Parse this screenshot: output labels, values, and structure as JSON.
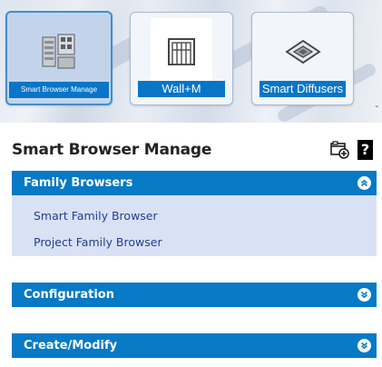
{
  "tiles": [
    {
      "label": "Smart Browser Manage",
      "icon": "browser-manager-icon",
      "selected": true
    },
    {
      "label": "Wall+M",
      "icon": "wall-frame-icon",
      "selected": false
    },
    {
      "label": "Smart Diffusers",
      "icon": "diffuser-icon",
      "selected": false
    }
  ],
  "panel": {
    "title": "Smart Browser Manage",
    "tools": {
      "add_icon": "add-tab-icon",
      "help_label": "?"
    }
  },
  "sections": [
    {
      "label": "Family Browsers",
      "expanded": true,
      "items": [
        "Smart Family Browser",
        "Project Family Browser"
      ]
    },
    {
      "label": "Configuration",
      "expanded": false,
      "items": []
    },
    {
      "label": "Create/Modify",
      "expanded": false,
      "items": []
    }
  ],
  "colors": {
    "header_blue": "#0779c5",
    "body_lavender": "#d9e1f5",
    "link_blue": "#1f3f8e",
    "selected_tile": "#c3d4ea"
  }
}
